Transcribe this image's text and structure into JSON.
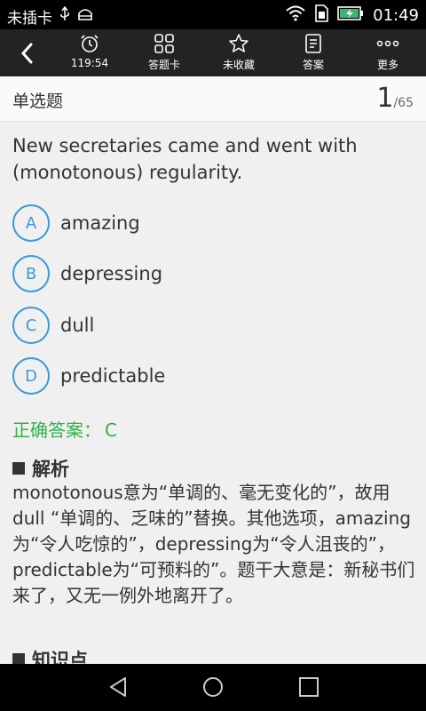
{
  "status_bar": {
    "carrier": "未插卡",
    "time": "01:49",
    "icons": [
      "usb-icon",
      "android-icon",
      "wifi-icon",
      "sim-icon",
      "battery-charging-icon"
    ]
  },
  "toolbar": {
    "back_icon": "back-arrow-icon",
    "items": [
      {
        "icon": "alarm-clock-icon",
        "label": "119:54"
      },
      {
        "icon": "grid-icon",
        "label": "答题卡"
      },
      {
        "icon": "star-outline-icon",
        "label": "未收藏"
      },
      {
        "icon": "document-icon",
        "label": "答案"
      },
      {
        "icon": "more-dots-icon",
        "label": "更多"
      }
    ]
  },
  "subheader": {
    "question_type": "单选题",
    "current": "1",
    "total": "/65"
  },
  "question": {
    "text": "New secretaries came and went with (monotonous) regularity."
  },
  "options": [
    {
      "letter": "A",
      "text": "amazing"
    },
    {
      "letter": "B",
      "text": "depressing"
    },
    {
      "letter": "C",
      "text": "dull"
    },
    {
      "letter": "D",
      "text": "predictable"
    }
  ],
  "answer": {
    "label": "正确答案：",
    "letter": "C"
  },
  "analysis": {
    "title": "解析",
    "body": "monotonous意为“单调的、毫无变化的”，故用dull “单调的、乏味的”替换。其他选项，amazing为“令人吃惊的”，depressing为“令人沮丧的”，predictable为“可预料的”。题干大意是：新秘书们来了，又无一例外地离开了。"
  },
  "knowledge": {
    "title": "知识点"
  },
  "nav_bar": {
    "icons": [
      "back-triangle-icon",
      "home-circle-icon",
      "recent-square-icon"
    ]
  },
  "colors": {
    "accent": "#3a9ad9",
    "correct": "#2db24a",
    "toolbar": "#232323"
  }
}
